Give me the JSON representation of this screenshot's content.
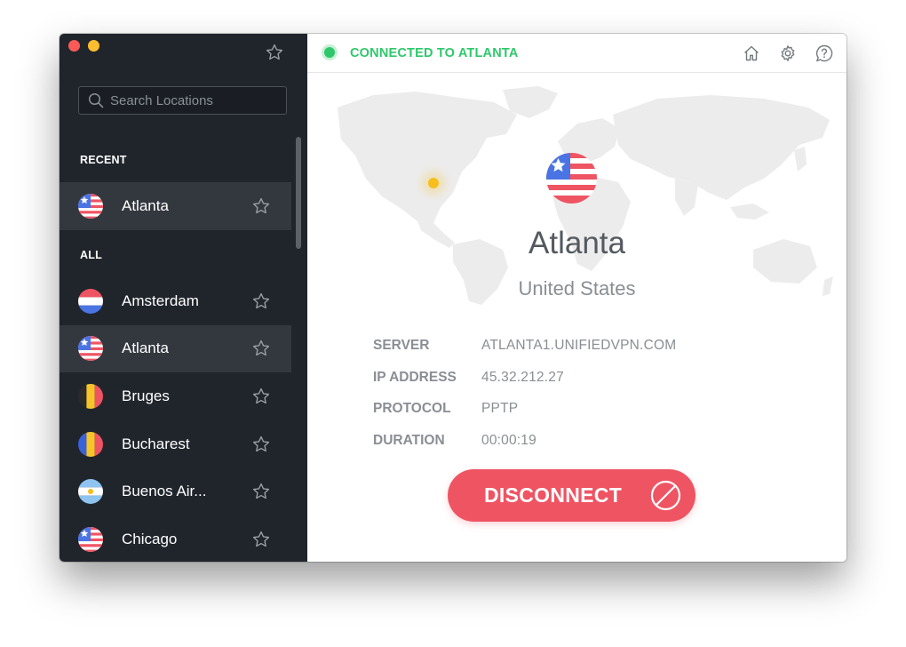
{
  "sidebar": {
    "search": {
      "placeholder": "Search Locations",
      "value": ""
    },
    "recent_label": "RECENT",
    "recent": [
      {
        "name": "Atlanta",
        "flag": "us",
        "active": true
      }
    ],
    "all_label": "ALL",
    "locations": [
      {
        "name": "Amsterdam",
        "flag": "nl",
        "active": false
      },
      {
        "name": "Atlanta",
        "flag": "us",
        "active": true
      },
      {
        "name": "Bruges",
        "flag": "be",
        "active": false
      },
      {
        "name": "Bucharest",
        "flag": "ro",
        "active": false
      },
      {
        "name": "Buenos Air...",
        "flag": "ar",
        "active": false
      },
      {
        "name": "Chicago",
        "flag": "us",
        "active": false
      }
    ]
  },
  "status": {
    "text": "CONNECTED TO ATLANTA",
    "color": "#2ec86b"
  },
  "connection": {
    "city": "Atlanta",
    "country": "United States",
    "details": [
      {
        "label": "SERVER",
        "value": "ATLANTA1.UNIFIEDVPN.COM"
      },
      {
        "label": "IP ADDRESS",
        "value": "45.32.212.27"
      },
      {
        "label": "PROTOCOL",
        "value": "PPTP"
      },
      {
        "label": "DURATION",
        "value": "00:00:19"
      }
    ]
  },
  "disconnect_label": "DISCONNECT",
  "icons": {
    "favorite": "star-icon",
    "home": "home-icon",
    "settings": "gear-icon",
    "help": "help-icon",
    "disconnect": "no-entry-icon"
  },
  "colors": {
    "sidebar_bg": "#20252c",
    "active_row": "#33383f",
    "accent_red": "#ef5463",
    "connected_green": "#2ec86b",
    "location_dot": "#f7be1d"
  }
}
